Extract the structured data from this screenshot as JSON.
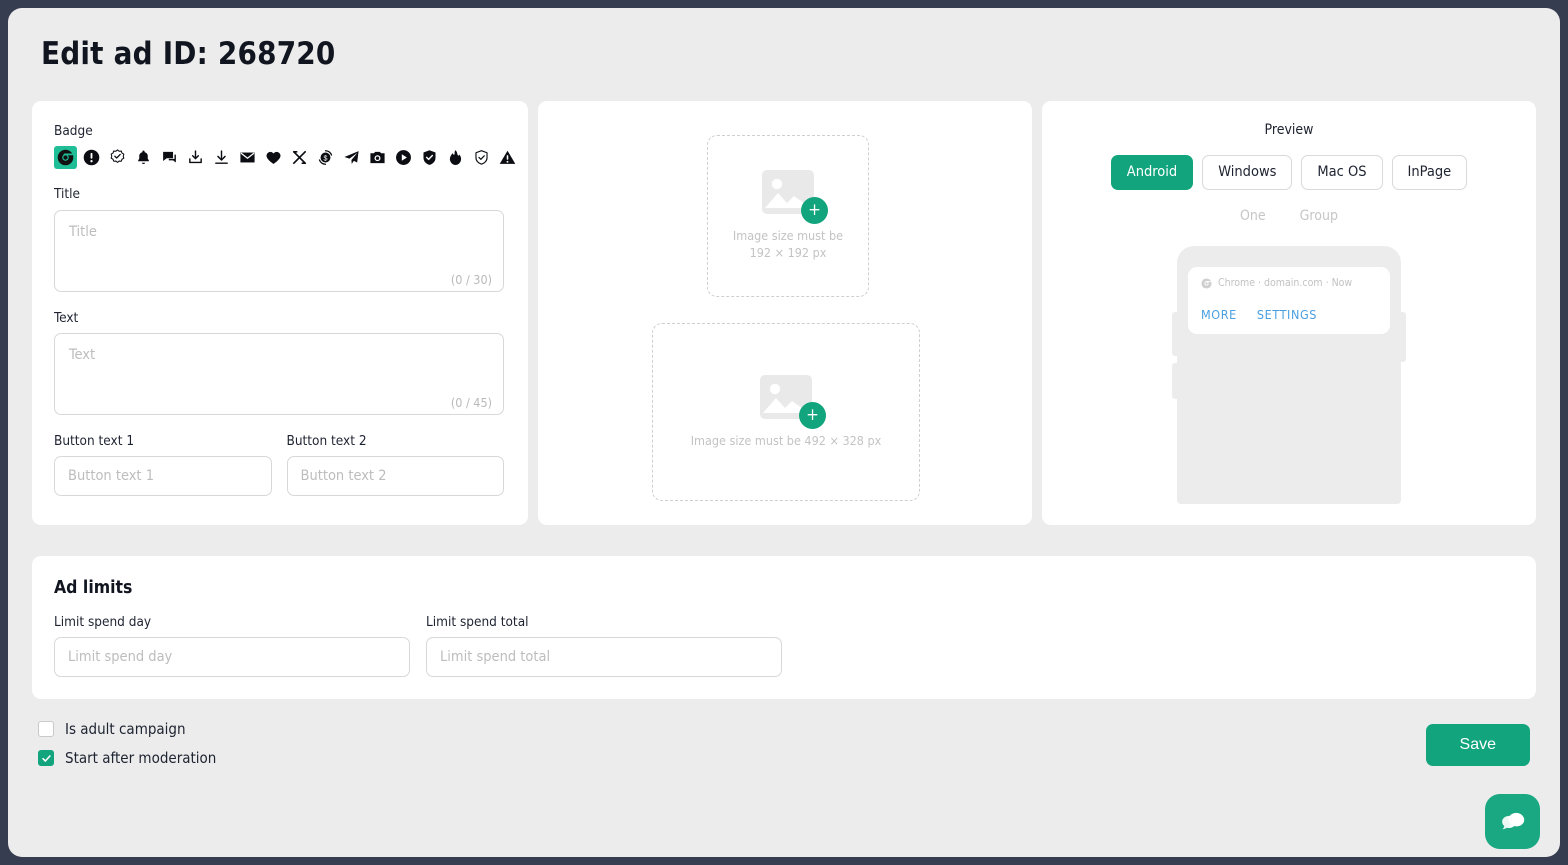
{
  "page": {
    "title": "Edit ad ID: 268720"
  },
  "form": {
    "badge_label": "Badge",
    "badges": [
      {
        "icon": "chrome-icon",
        "selected": true
      },
      {
        "icon": "exclamation-circle-icon",
        "selected": false
      },
      {
        "icon": "check-badge-icon",
        "selected": false
      },
      {
        "icon": "bell-icon",
        "selected": false
      },
      {
        "icon": "chat-bubble-icon",
        "selected": false
      },
      {
        "icon": "download-tray-icon",
        "selected": false
      },
      {
        "icon": "download-arrow-icon",
        "selected": false
      },
      {
        "icon": "envelope-icon",
        "selected": false
      },
      {
        "icon": "heart-icon",
        "selected": false
      },
      {
        "icon": "shuffle-icon",
        "selected": false
      },
      {
        "icon": "money-refresh-icon",
        "selected": false
      },
      {
        "icon": "paper-plane-icon",
        "selected": false
      },
      {
        "icon": "camera-icon",
        "selected": false
      },
      {
        "icon": "play-circle-icon",
        "selected": false
      },
      {
        "icon": "shield-check-filled-icon",
        "selected": false
      },
      {
        "icon": "flame-icon",
        "selected": false
      },
      {
        "icon": "shield-check-outline-icon",
        "selected": false
      },
      {
        "icon": "warning-triangle-icon",
        "selected": false
      }
    ],
    "title_label": "Title",
    "title_placeholder": "Title",
    "title_value": "",
    "title_counter": "(0 / 30)",
    "text_label": "Text",
    "text_placeholder": "Text",
    "text_value": "",
    "text_counter": "(0 / 45)",
    "button1_label": "Button text 1",
    "button1_placeholder": "Button text 1",
    "button1_value": "",
    "button2_label": "Button text 2",
    "button2_placeholder": "Button text 2",
    "button2_value": ""
  },
  "media": {
    "icon_name": "image-placeholder-icon",
    "add_glyph": "+",
    "square": {
      "line1": "Image size must be",
      "line2": "192 × 192 px"
    },
    "wide": {
      "line1": "Image size must be 492 × 328 px",
      "line2": ""
    }
  },
  "preview": {
    "heading": "Preview",
    "os_tabs": [
      {
        "label": "Android",
        "active": true
      },
      {
        "label": "Windows",
        "active": false
      },
      {
        "label": "Mac OS",
        "active": false
      },
      {
        "label": "InPage",
        "active": false
      }
    ],
    "sub_tabs": [
      {
        "label": "One",
        "active": false
      },
      {
        "label": "Group",
        "active": false
      }
    ],
    "notification": {
      "source_icon": "chrome-small-icon",
      "meta": "Chrome · domain.com · Now",
      "action_more": "MORE",
      "action_settings": "SETTINGS"
    }
  },
  "ad_limits": {
    "heading": "Ad limits",
    "spend_day_label": "Limit spend day",
    "spend_day_placeholder": "Limit spend day",
    "spend_day_value": "",
    "spend_total_label": "Limit spend total",
    "spend_total_placeholder": "Limit spend total",
    "spend_total_value": ""
  },
  "footer": {
    "adult_label": "Is adult campaign",
    "adult_checked": false,
    "moderation_label": "Start after moderation",
    "moderation_checked": true,
    "save_label": "Save",
    "chat_icon": "chat-bubbles-icon"
  },
  "colors": {
    "accent": "#12a47d",
    "accent_badge": "#1fbe96",
    "page_bg": "#ececec",
    "outer_bg": "#373d50",
    "link": "#4a9fe0"
  }
}
